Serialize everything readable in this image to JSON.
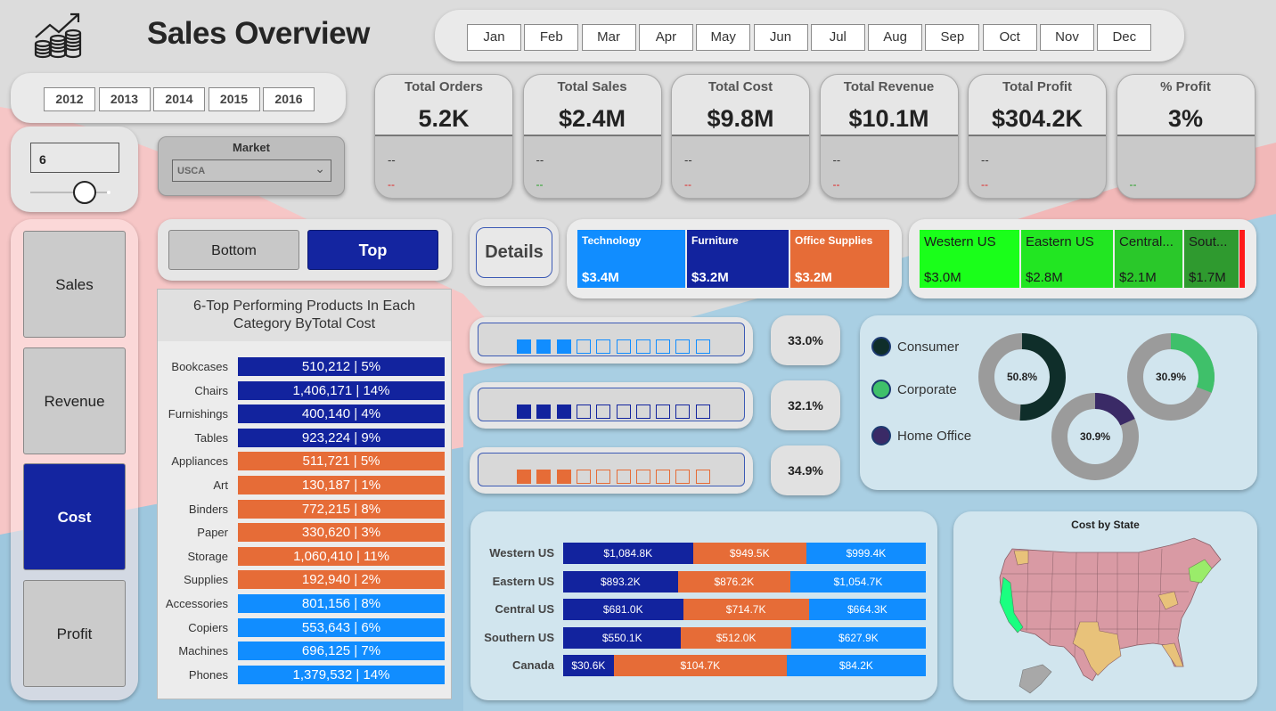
{
  "header": {
    "title": "Sales Overview",
    "logo_icon": "growth-chart-coins-icon"
  },
  "months": [
    "Jan",
    "Feb",
    "Mar",
    "Apr",
    "May",
    "Jun",
    "Jul",
    "Aug",
    "Sep",
    "Oct",
    "Nov",
    "Dec"
  ],
  "years": [
    "2012",
    "2013",
    "2014",
    "2015",
    "2016"
  ],
  "slider": {
    "value": "6"
  },
  "market": {
    "label": "Market",
    "selected": "USCA"
  },
  "kpis": [
    {
      "label": "Total Orders",
      "value": "5.2K",
      "line1": "--",
      "line2": "--",
      "line2_color": "#e02020"
    },
    {
      "label": "Total Sales",
      "value": "$2.4M",
      "line1": "--",
      "line2": "--",
      "line2_color": "#1e9e1e"
    },
    {
      "label": "Total Cost",
      "value": "$9.8M",
      "line1": "--",
      "line2": "--",
      "line2_color": "#e02020"
    },
    {
      "label": "Total Revenue",
      "value": "$10.1M",
      "line1": "--",
      "line2": "--",
      "line2_color": "#e02020"
    },
    {
      "label": "Total Profit",
      "value": "$304.2K",
      "line1": "--",
      "line2": "--",
      "line2_color": "#e02020"
    },
    {
      "label": "% Profit",
      "value": "3%",
      "line1": "",
      "line2": "--",
      "line2_color": "#1e9e1e"
    }
  ],
  "nav": {
    "items": [
      "Sales",
      "Revenue",
      "Cost",
      "Profit"
    ],
    "active": "Cost"
  },
  "toggle": {
    "bottom": "Bottom",
    "top": "Top",
    "active": "Top"
  },
  "details_button": "Details",
  "colors": {
    "technology": "#118dff",
    "furniture": "#12239e",
    "office_supplies": "#e66c37",
    "accent": "#1425a0"
  },
  "category_totals": [
    {
      "name": "Technology",
      "value": "$3.4M",
      "color": "#118dff"
    },
    {
      "name": "Furniture",
      "value": "$3.2M",
      "color": "#12239e"
    },
    {
      "name": "Office Supplies",
      "value": "$3.2M",
      "color": "#e66c37"
    }
  ],
  "region_totals": [
    {
      "name": "Western US",
      "value": "$3.0M",
      "color": "#1aff1a"
    },
    {
      "name": "Eastern US",
      "value": "$2.8M",
      "color": "#22e622"
    },
    {
      "name": "Central...",
      "value": "$2.1M",
      "color": "#2ac82a"
    },
    {
      "name": "Sout...",
      "value": "$1.7M",
      "color": "#2f9a2f"
    }
  ],
  "share_bars": [
    {
      "pct": "33.0%",
      "filled": 3,
      "total": 10,
      "color": "#118dff"
    },
    {
      "pct": "32.1%",
      "filled": 3,
      "total": 10,
      "color": "#12239e"
    },
    {
      "pct": "34.9%",
      "filled": 3,
      "total": 10,
      "color": "#e66c37"
    }
  ],
  "segments_legend": [
    {
      "name": "Consumer",
      "color": "#0f2e2a"
    },
    {
      "name": "Corporate",
      "color": "#3fc06a"
    },
    {
      "name": "Home Office",
      "color": "#3a2a66"
    }
  ],
  "map": {
    "title": "Cost by State"
  },
  "chart_data": [
    {
      "type": "bar",
      "orientation": "horizontal",
      "title": "6-Top Performing Products In Each Category ByTotal Cost",
      "categories": [
        "Bookcases",
        "Chairs",
        "Furnishings",
        "Tables",
        "Appliances",
        "Art",
        "Binders",
        "Paper",
        "Storage",
        "Supplies",
        "Accessories",
        "Copiers",
        "Machines",
        "Phones"
      ],
      "values": [
        510212,
        1406171,
        400140,
        923224,
        511721,
        130187,
        772215,
        330620,
        1060410,
        192940,
        801156,
        553643,
        696125,
        1379532
      ],
      "labels": [
        "510,212 | 5%",
        "1,406,171 | 14%",
        "400,140 | 4%",
        "923,224 | 9%",
        "511,721 | 5%",
        "130,187 | 1%",
        "772,215 | 8%",
        "330,620 | 3%",
        "1,060,410 | 11%",
        "192,940 | 2%",
        "801,156 | 8%",
        "553,643 | 6%",
        "696,125 | 7%",
        "1,379,532 | 14%"
      ],
      "groups": [
        "Furniture",
        "Furniture",
        "Furniture",
        "Furniture",
        "Office Supplies",
        "Office Supplies",
        "Office Supplies",
        "Office Supplies",
        "Office Supplies",
        "Office Supplies",
        "Technology",
        "Technology",
        "Technology",
        "Technology"
      ]
    },
    {
      "type": "bar",
      "orientation": "horizontal",
      "stacked": true,
      "categories": [
        "Western US",
        "Eastern US",
        "Central US",
        "Southern US",
        "Canada"
      ],
      "series": [
        {
          "values": [
            1084.8,
            893.2,
            681.0,
            550.1,
            30.6
          ],
          "labels": [
            "$1,084.8K",
            "$893.2K",
            "$681.0K",
            "$550.1K",
            "$30.6K"
          ],
          "color": "#12239e"
        },
        {
          "values": [
            949.5,
            876.2,
            714.7,
            512.0,
            104.7
          ],
          "labels": [
            "$949.5K",
            "$876.2K",
            "$714.7K",
            "$512.0K",
            "$104.7K"
          ],
          "color": "#e66c37"
        },
        {
          "values": [
            999.4,
            1054.7,
            664.3,
            627.9,
            84.2
          ],
          "labels": [
            "$999.4K",
            "$1,054.7K",
            "$664.3K",
            "$627.9K",
            "$84.2K"
          ],
          "color": "#118dff"
        }
      ]
    },
    {
      "type": "pie",
      "donut": true,
      "series": [
        {
          "name": "Consumer",
          "value": 50.8,
          "label": "50.8%",
          "color": "#0f2e2a"
        },
        {
          "name": "Corporate",
          "value": 30.9,
          "label": "30.9%",
          "color": "#3fc06a"
        },
        {
          "name": "Home Office",
          "value": 18.3,
          "label": "30.9%",
          "color": "#3a2a66"
        }
      ]
    }
  ]
}
